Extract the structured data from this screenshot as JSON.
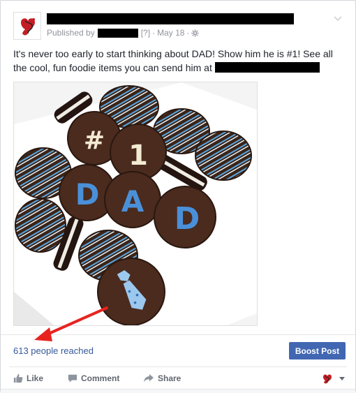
{
  "post": {
    "published_by_label": "Published by",
    "help_marker": "[?]",
    "separator": "·",
    "date": "May 18",
    "separator2": "·",
    "text_line": "It's never too early to start thinking about DAD! Show him he is #1! See all the cool, fun foodie items you can send him at"
  },
  "stats": {
    "reach_text": "613 people reached",
    "boost_label": "Boost Post"
  },
  "actions": {
    "like_label": "Like",
    "comment_label": "Comment",
    "share_label": "Share"
  },
  "colors": {
    "link": "#365899",
    "boost_bg": "#4267b2",
    "arrow": "#e8231f"
  },
  "icons": [
    "gear-icon",
    "chevron-down-icon",
    "like-icon",
    "comment-icon",
    "share-icon",
    "actor-avatar-icon",
    "dropdown-caret-icon"
  ]
}
